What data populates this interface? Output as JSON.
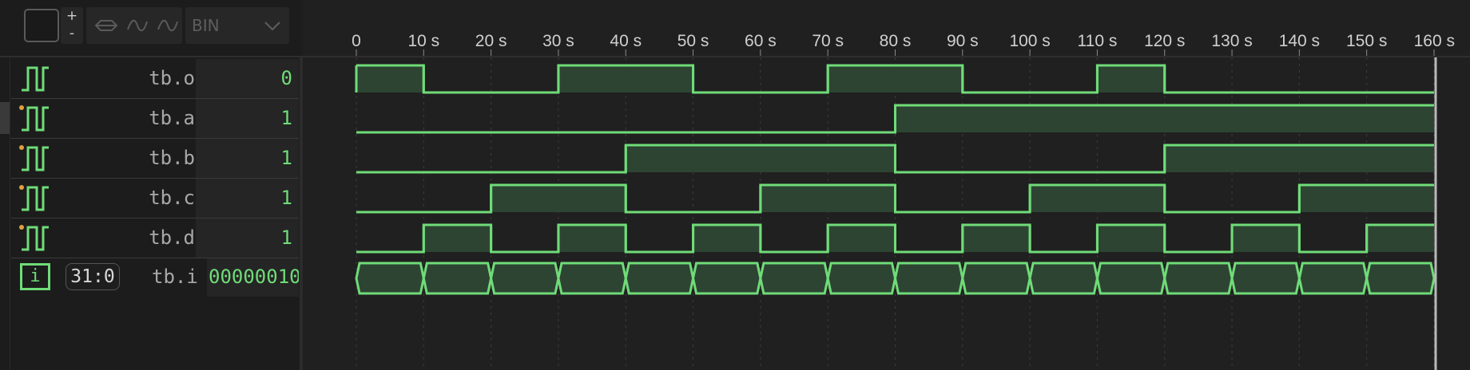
{
  "toolbar": {
    "plus_label": "+",
    "minus_label": "-",
    "format_select": "BIN",
    "colors": {
      "disabled": "#5a5a5a",
      "panel": "#2a2a2a"
    }
  },
  "timeline": {
    "ticks": [
      "0",
      "10 s",
      "20 s",
      "30 s",
      "40 s",
      "50 s",
      "60 s",
      "70 s",
      "80 s",
      "90 s",
      "100 s",
      "110 s",
      "120 s",
      "130 s",
      "140 s",
      "150 s",
      "160 s"
    ],
    "time_start": 0,
    "time_end": 160,
    "tick_step": 10,
    "cursor_time": 160,
    "colors": {
      "wave": "#6fdc78",
      "fill": "#2e4433",
      "grid": "#3c3c3c",
      "cursor": "#b8b8b8"
    }
  },
  "signals": [
    {
      "name": "tb.o",
      "value": "0",
      "icon": "square-wave-icon",
      "input": false,
      "transitions": [
        [
          0,
          1
        ],
        [
          10,
          0
        ],
        [
          30,
          1
        ],
        [
          50,
          0
        ],
        [
          70,
          1
        ],
        [
          90,
          0
        ],
        [
          110,
          1
        ],
        [
          120,
          0
        ]
      ]
    },
    {
      "name": "tb.a",
      "value": "1",
      "icon": "square-wave-icon",
      "input": true,
      "transitions": [
        [
          0,
          0
        ],
        [
          80,
          1
        ]
      ]
    },
    {
      "name": "tb.b",
      "value": "1",
      "icon": "square-wave-icon",
      "input": true,
      "transitions": [
        [
          0,
          0
        ],
        [
          40,
          1
        ],
        [
          80,
          0
        ],
        [
          120,
          1
        ]
      ]
    },
    {
      "name": "tb.c",
      "value": "1",
      "icon": "square-wave-icon",
      "input": true,
      "transitions": [
        [
          0,
          0
        ],
        [
          20,
          1
        ],
        [
          40,
          0
        ],
        [
          60,
          1
        ],
        [
          80,
          0
        ],
        [
          100,
          1
        ],
        [
          120,
          0
        ],
        [
          140,
          1
        ]
      ]
    },
    {
      "name": "tb.d",
      "value": "1",
      "icon": "square-wave-icon",
      "input": true,
      "transitions": [
        [
          0,
          0
        ],
        [
          10,
          1
        ],
        [
          20,
          0
        ],
        [
          30,
          1
        ],
        [
          40,
          0
        ],
        [
          50,
          1
        ],
        [
          60,
          0
        ],
        [
          70,
          1
        ],
        [
          80,
          0
        ],
        [
          90,
          1
        ],
        [
          100,
          0
        ],
        [
          110,
          1
        ],
        [
          120,
          0
        ],
        [
          130,
          1
        ],
        [
          140,
          0
        ],
        [
          150,
          1
        ]
      ]
    }
  ],
  "bus": {
    "name": "tb.i",
    "width": "31:0",
    "value": "00000010",
    "icon_label": "i",
    "segment_times": [
      0,
      10,
      20,
      30,
      40,
      50,
      60,
      70,
      80,
      90,
      100,
      110,
      120,
      130,
      140,
      150,
      160
    ]
  }
}
